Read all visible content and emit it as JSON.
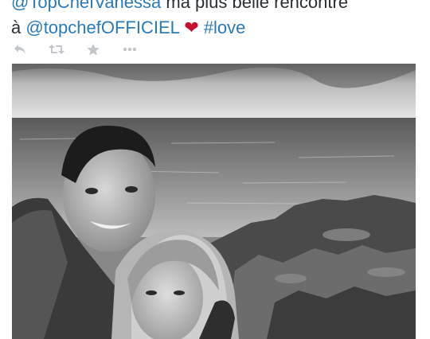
{
  "tweet": {
    "line1_mention": "@TopChefVanessa",
    "line1_text": " ma plus belle rencontre",
    "line2_prefix": "à ",
    "line2_mention": "@topchefOFFICIEL",
    "heart": "❤",
    "hashtag": "#love"
  },
  "actions": [
    {
      "name": "reply",
      "icon": "reply-icon"
    },
    {
      "name": "retweet",
      "icon": "retweet-icon"
    },
    {
      "name": "favorite",
      "icon": "star-icon"
    },
    {
      "name": "more",
      "icon": "more-dots-icon"
    }
  ],
  "colors": {
    "text": "#292f33",
    "link": "#2a7ab8",
    "heart": "#c8102e",
    "action_icon": "#c3c7cb"
  },
  "media": {
    "type": "photo",
    "style": "black-and-white"
  }
}
